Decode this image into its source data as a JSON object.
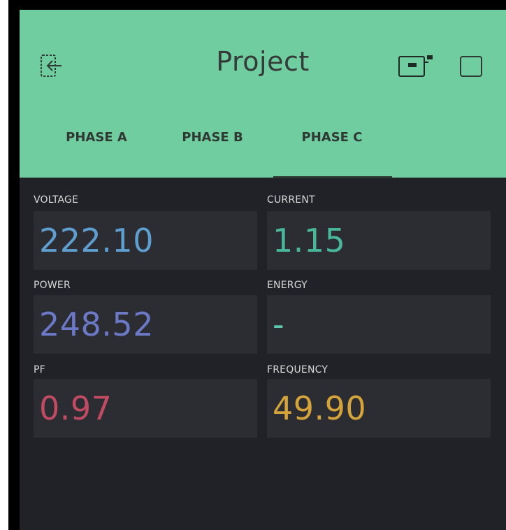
{
  "app": {
    "title": "Project"
  },
  "tabs": [
    {
      "label": "PHASE A"
    },
    {
      "label": "PHASE B"
    },
    {
      "label": "PHASE C",
      "active": true
    }
  ],
  "metrics": {
    "voltage": {
      "label": "VOLTAGE",
      "value": "222.10",
      "color": "#5f9fd0"
    },
    "current": {
      "label": "CURRENT",
      "value": "1.15",
      "color": "#49b89a"
    },
    "power": {
      "label": "POWER",
      "value": "248.52",
      "color": "#6b79c6"
    },
    "energy": {
      "label": "ENERGY",
      "value": "-",
      "color": "#58c9ad"
    },
    "pf": {
      "label": "PF",
      "value": "0.97",
      "color": "#c04b62"
    },
    "frequency": {
      "label": "FREQUENCY",
      "value": "49.90",
      "color": "#d4a43a"
    }
  },
  "colors": {
    "header_bg": "#6fcda0",
    "app_bg": "#212227",
    "box_bg": "#2c2d33"
  }
}
